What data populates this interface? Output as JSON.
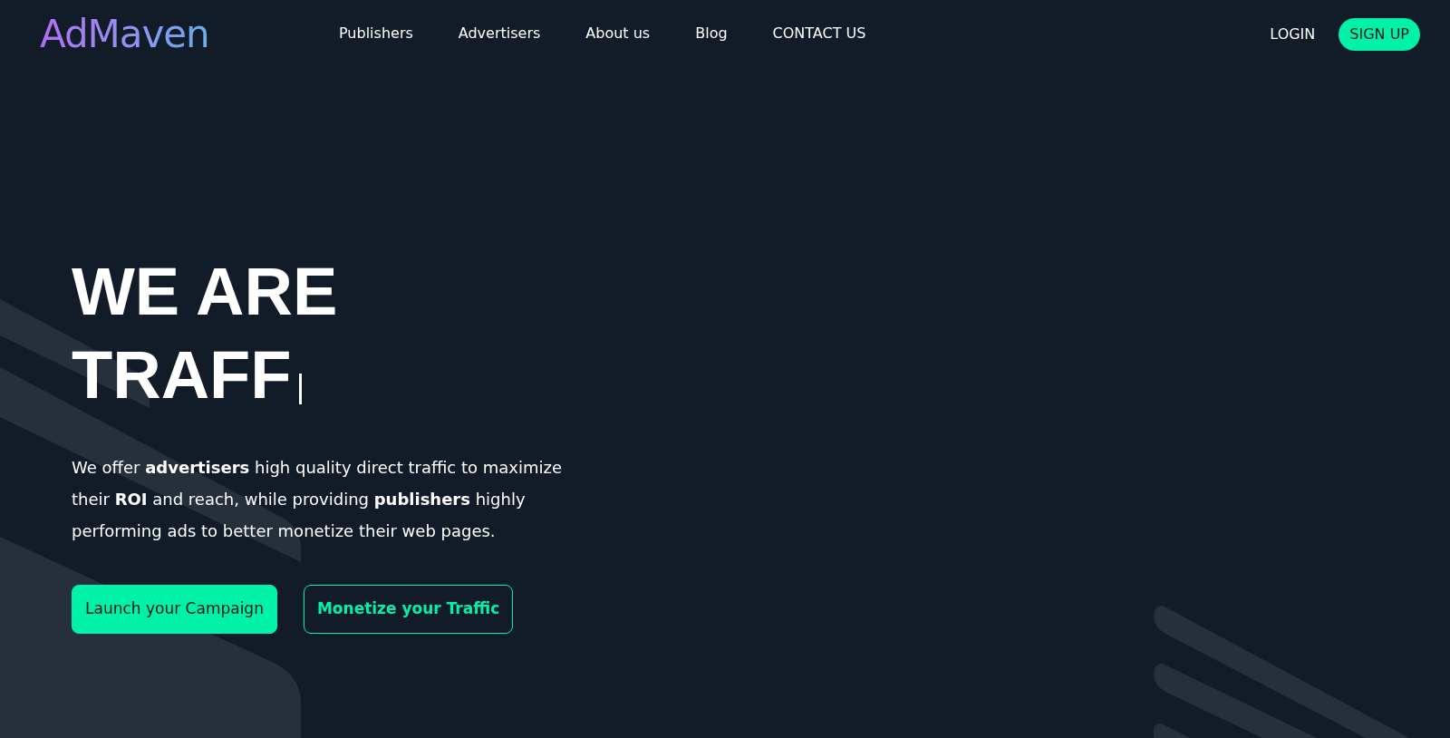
{
  "header": {
    "logo": "AdMaven",
    "nav": [
      {
        "label": "Publishers"
      },
      {
        "label": "Advertisers"
      },
      {
        "label": "About us"
      },
      {
        "label": "Blog"
      },
      {
        "label": "CONTACT US"
      }
    ],
    "login": "LOGIN",
    "signup": "SIGN UP"
  },
  "hero": {
    "headline_lines": [
      "WE ARE",
      "TRAFF"
    ],
    "description": "We offer **advertisers** high quality direct traffic to maximize their **ROI** and reach, while providing **publishers** highly performing ads to better monetize their web pages.",
    "buttons": [
      {
        "kind": "primary",
        "label": "Launch your Campaign"
      },
      {
        "kind": "outline",
        "label": "Monetize your Traffic"
      }
    ]
  }
}
